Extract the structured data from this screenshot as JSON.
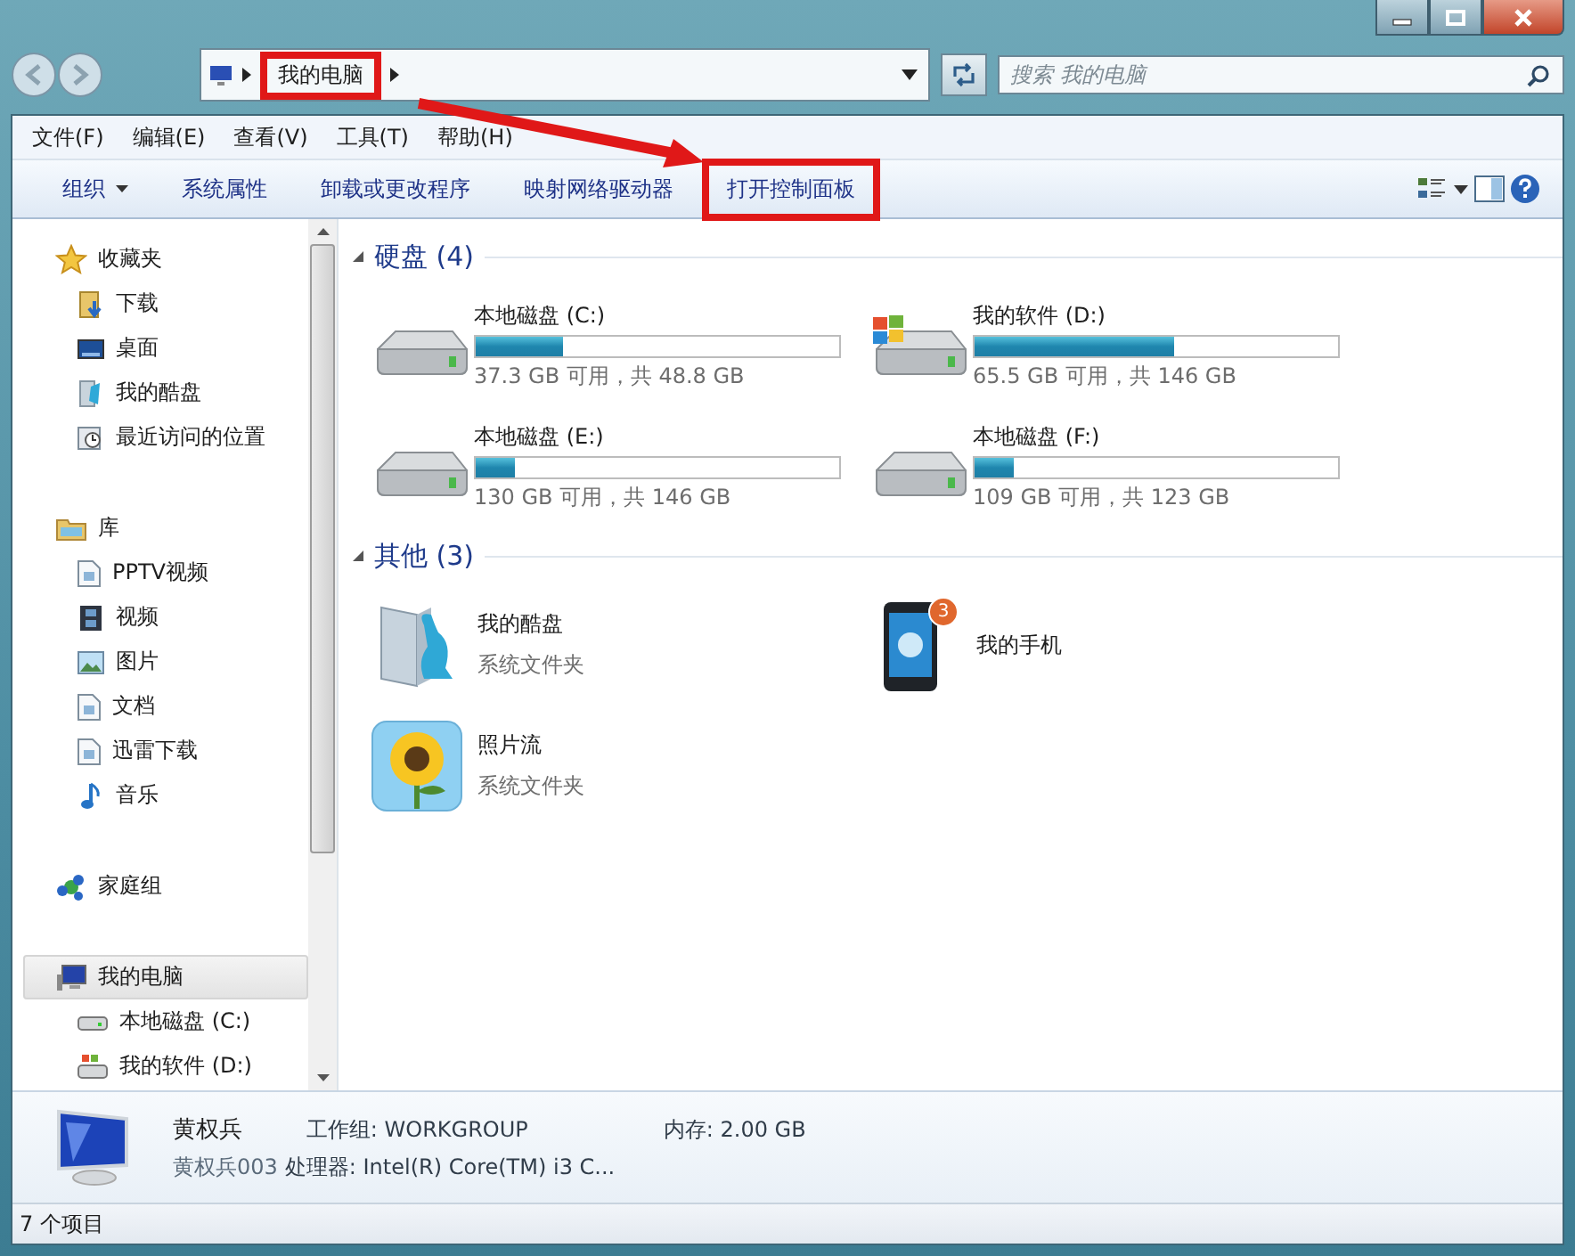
{
  "address": {
    "crumbs": [
      {
        "label": "我的电脑",
        "highlighted": true
      }
    ]
  },
  "search": {
    "placeholder": "搜索 我的电脑"
  },
  "menu": [
    "文件(F)",
    "编辑(E)",
    "查看(V)",
    "工具(T)",
    "帮助(H)"
  ],
  "toolbar": [
    {
      "label": "组织",
      "kind": "dropdown",
      "highlighted": false
    },
    {
      "label": "系统属性",
      "kind": "button",
      "highlighted": false
    },
    {
      "label": "卸载或更改程序",
      "kind": "button",
      "highlighted": false
    },
    {
      "label": "映射网络驱动器",
      "kind": "button",
      "highlighted": false
    },
    {
      "label": "打开控制面板",
      "kind": "button",
      "highlighted": true
    }
  ],
  "annotation": {
    "arrow": true
  },
  "sidebar": [
    {
      "label": "收藏夹",
      "selected": false,
      "children": [
        {
          "label": "下载",
          "selected": false
        },
        {
          "label": "桌面",
          "selected": false
        },
        {
          "label": "我的酷盘",
          "selected": false
        },
        {
          "label": "最近访问的位置",
          "selected": false
        }
      ]
    },
    {
      "label": "库",
      "selected": false,
      "children": [
        {
          "label": "PPTV视频",
          "selected": false
        },
        {
          "label": "视频",
          "selected": false
        },
        {
          "label": "图片",
          "selected": false
        },
        {
          "label": "文档",
          "selected": false
        },
        {
          "label": "迅雷下载",
          "selected": false
        },
        {
          "label": "音乐",
          "selected": false
        }
      ]
    },
    {
      "label": "家庭组",
      "selected": false
    },
    {
      "label": "我的电脑",
      "selected": true,
      "children": [
        {
          "label": "本地磁盘 (C:)",
          "selected": false
        },
        {
          "label": "我的软件 (D:)",
          "selected": false
        }
      ]
    }
  ],
  "sections": [
    {
      "title": "硬盘 (4)",
      "kind": "drives",
      "items": [
        {
          "name": "本地磁盘 (C:)",
          "detail": "37.3 GB 可用，共 48.8 GB",
          "level": 0.24
        },
        {
          "name": "我的软件 (D:)",
          "detail": "65.5 GB 可用，共 146 GB",
          "level": 0.55
        },
        {
          "name": "本地磁盘 (E:)",
          "detail": "130 GB 可用，共 146 GB",
          "level": 0.11
        },
        {
          "name": "本地磁盘 (F:)",
          "detail": "109 GB 可用，共 123 GB",
          "level": 0.11
        }
      ]
    },
    {
      "title": "其他 (3)",
      "kind": "others",
      "items": [
        {
          "name": "我的酷盘",
          "detail": "系统文件夹"
        },
        {
          "name": "我的手机",
          "badge": "3"
        },
        {
          "name": "照片流",
          "detail": "系统文件夹"
        }
      ]
    }
  ],
  "details": {
    "name": "黄权兵",
    "subname": "黄权兵003",
    "workgroup": "工作组: WORKGROUP",
    "memory": "内存: 2.00 GB",
    "processor": "处理器: Intel(R) Core(TM) i3 C..."
  },
  "status_bar": "7 个项目"
}
